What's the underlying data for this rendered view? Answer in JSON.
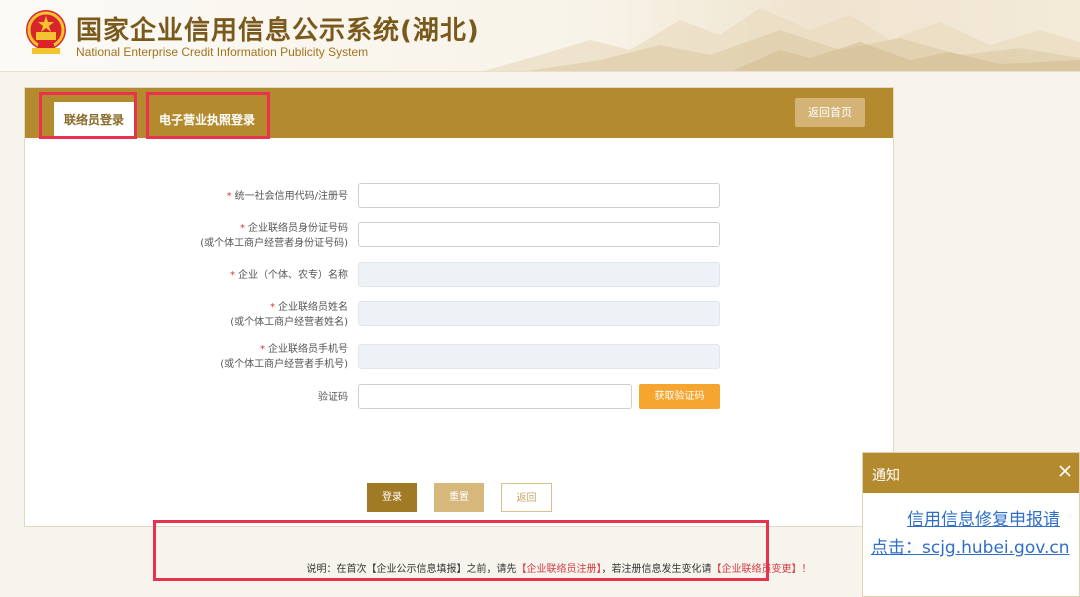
{
  "header": {
    "title_cn": "国家企业信用信息公示系统(湖北)",
    "title_en": "National Enterprise Credit Information Publicity System",
    "emblem_icon": "national-emblem-icon"
  },
  "tabs": [
    {
      "label": "联络员登录",
      "active": true
    },
    {
      "label": "电子营业执照登录",
      "active": false
    }
  ],
  "back_home_label": "返回首页",
  "form": {
    "fields": [
      {
        "required": true,
        "label": "统一社会信用代码/注册号",
        "sublabel": "",
        "value": "",
        "disabled": false
      },
      {
        "required": true,
        "label": "企业联络员身份证号码",
        "sublabel": "(或个体工商户经营者身份证号码)",
        "value": "",
        "disabled": false
      },
      {
        "required": true,
        "label": "企业（个体、农专）名称",
        "sublabel": "",
        "value": "",
        "disabled": true
      },
      {
        "required": true,
        "label": "企业联络员姓名",
        "sublabel": "(或个体工商户经营者姓名)",
        "value": "",
        "disabled": true
      },
      {
        "required": true,
        "label": "企业联络员手机号",
        "sublabel": "(或个体工商户经营者手机号)",
        "value": "",
        "disabled": true
      },
      {
        "required": false,
        "label": "验证码",
        "sublabel": "",
        "value": "",
        "disabled": false
      }
    ],
    "get_code_label": "获取验证码",
    "required_mark": "*"
  },
  "buttons": {
    "login": "登录",
    "reset": "重置",
    "back": "返回"
  },
  "note": {
    "prefix": "说明：在首次【企业公示信息填报】之前，请先",
    "link1": "【企业联络员注册】",
    "middle": "，若注册信息发生变化请",
    "link2": "【企业联络员变更】！"
  },
  "notification": {
    "title": "通知",
    "close_icon": "close-icon",
    "line1": "信用信息修复申报请",
    "line2": "点击：scjg.hubei.gov.cn"
  },
  "colors": {
    "brand_gold": "#b48a2e",
    "highlight_red": "#e8324e",
    "link_blue": "#2f6fc9",
    "orange": "#f6a52e"
  }
}
